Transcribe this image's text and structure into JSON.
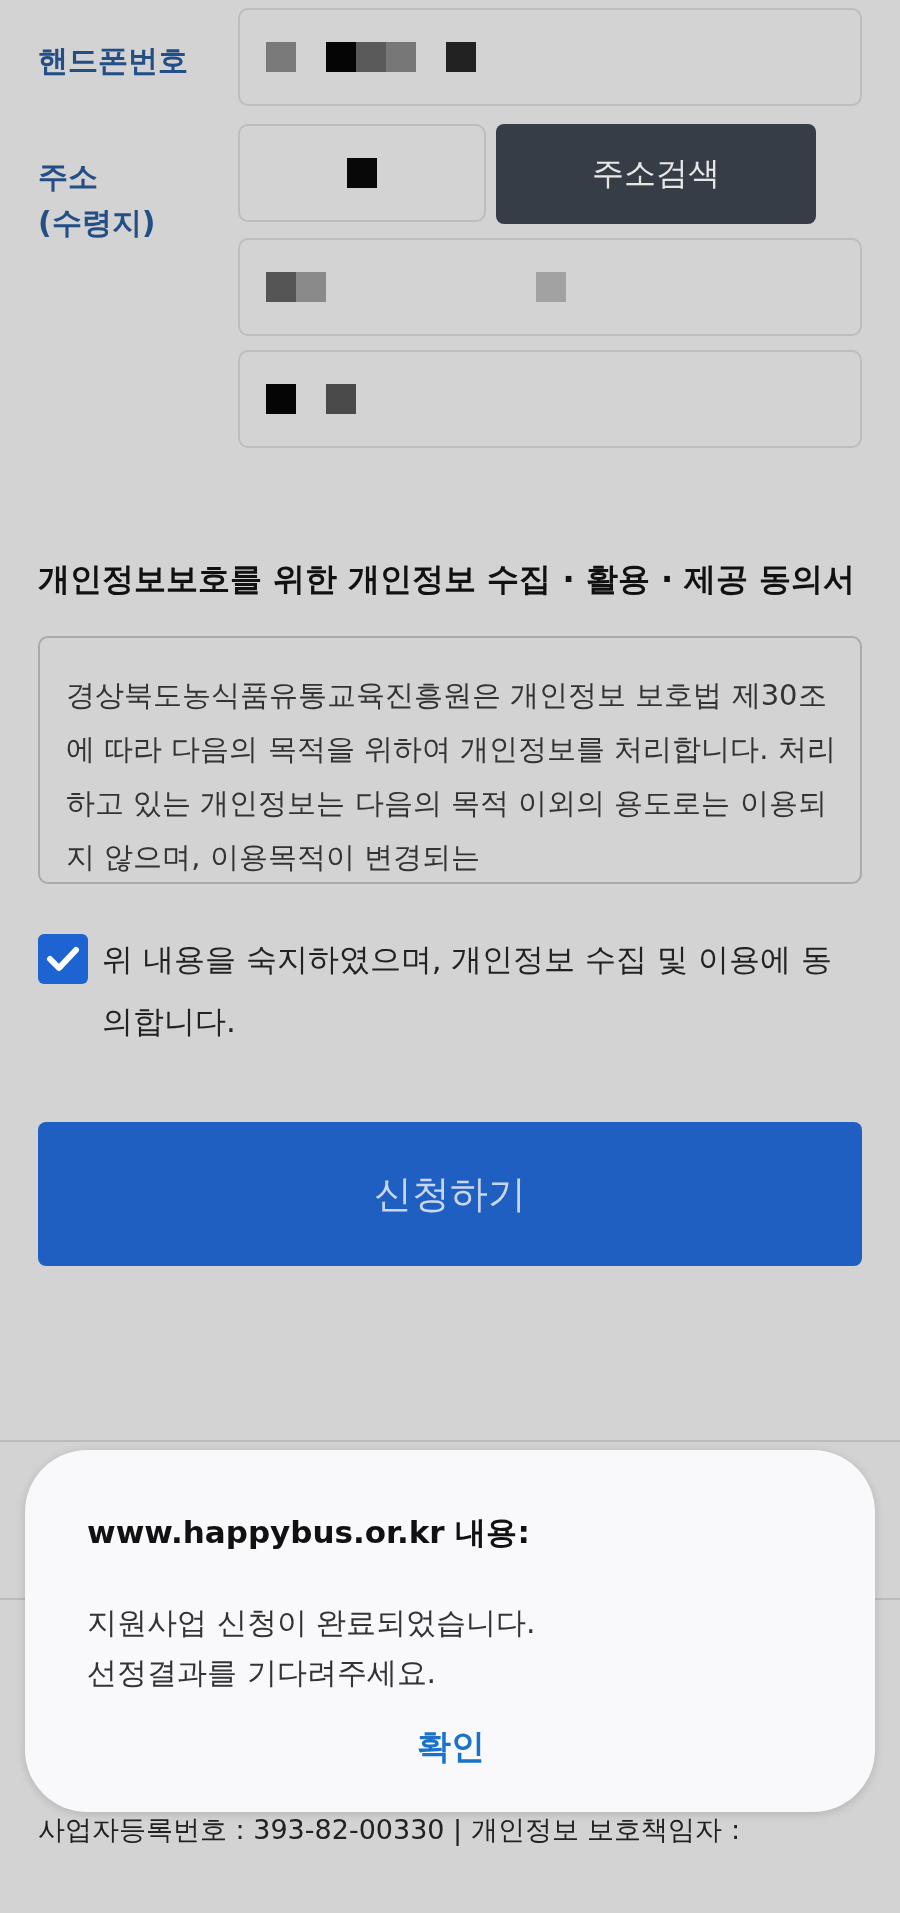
{
  "form": {
    "fields": [
      {
        "label": "핸드폰번호",
        "kind": "text",
        "value_redacted": true
      },
      {
        "label": "주소\n(수령지)",
        "kind": "address",
        "value_redacted": true,
        "button": "주소검색",
        "extra_lines": [
          {
            "value_redacted": true
          },
          {
            "value_redacted": true
          }
        ]
      }
    ]
  },
  "consent": {
    "title": "개인정보보호를 위한 개인정보 수집 · 활용 · 제공 동의서",
    "body": "경상북도농식품유통교육진흥원은 개인정보 보호법 제30조에 따라 다음의 목적을 위하여 개인정보를 처리합니다. 처리하고 있는 개인정보는 다음의 목적 이외의 용도로는 이용되지 않으며, 이용목적이 변경되는",
    "checkbox_label": "위 내용을 숙지하였으며, 개인정보 수집 및 이용에 동의합니다.",
    "checked": true
  },
  "submit_button": "신청하기",
  "footer": {
    "line": "사업자등록번호 : 393-82-00330 | 개인정보 보호책임자 :"
  },
  "dialog": {
    "title": "www.happybus.or.kr 내용:",
    "message": "지원사업 신청이 완료되었습니다.\n선정결과를 기다려주세요.",
    "confirm": "확인"
  }
}
